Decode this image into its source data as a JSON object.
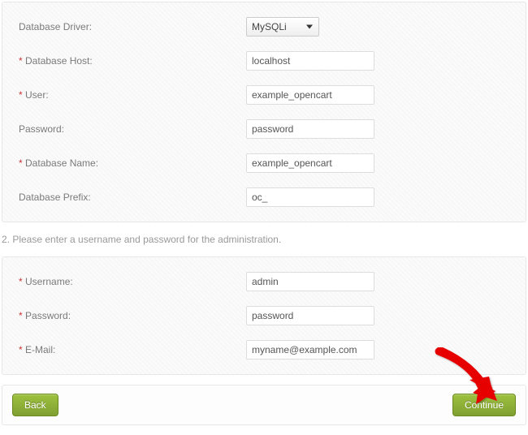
{
  "db": {
    "driver_label": "Database Driver:",
    "driver_value": "MySQLi",
    "host_label": "Database Host:",
    "host_value": "localhost",
    "user_label": "User:",
    "user_value": "example_opencart",
    "password_label": "Password:",
    "password_value": "password",
    "name_label": "Database Name:",
    "name_value": "example_opencart",
    "prefix_label": "Database Prefix:",
    "prefix_value": "oc_"
  },
  "step2_text": "2. Please enter a username and password for the administration.",
  "admin": {
    "username_label": "Username:",
    "username_value": "admin",
    "password_label": "Password:",
    "password_value": "password",
    "email_label": "E-Mail:",
    "email_value": "myname@example.com"
  },
  "buttons": {
    "back": "Back",
    "continue": "Continue"
  },
  "required_marker": "*"
}
